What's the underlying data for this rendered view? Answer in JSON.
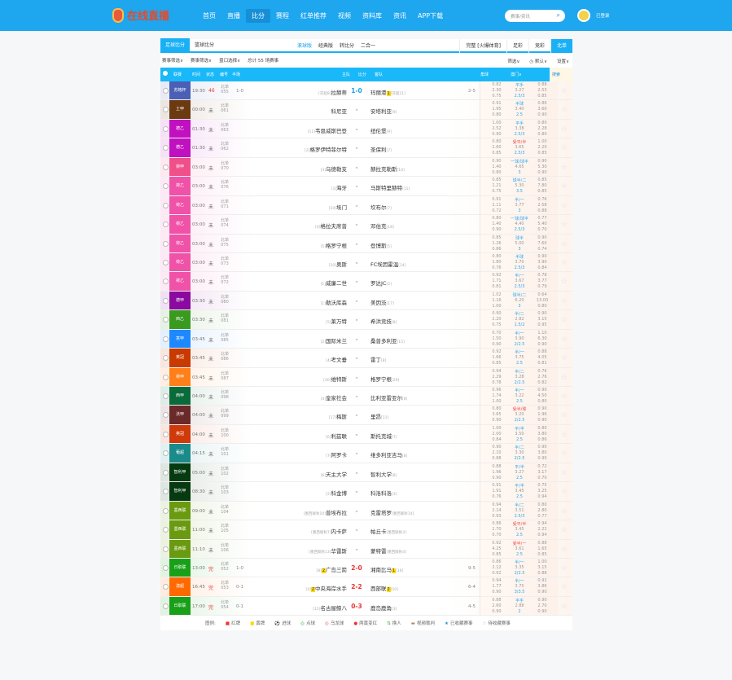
{
  "header": {
    "logo": "在线直播",
    "nav": [
      "首页",
      "直播",
      "比分",
      "赛程",
      "红单推荐",
      "视频",
      "资料库",
      "资讯",
      "APP下载"
    ],
    "active_nav": 2,
    "search_placeholder": "赛事/资讯",
    "user": "已登录"
  },
  "tabs": {
    "sport": [
      "足球比分",
      "篮球比分"
    ],
    "views": [
      "滚球版",
      "经典版",
      "转比分",
      "二合一"
    ],
    "right": [
      "完整 [火爆体育]",
      "足彩",
      "竞彩",
      "北单"
    ]
  },
  "filters": {
    "left": [
      "赛事筛选∨",
      "赛事筛选∨",
      "盘口选择∨",
      "总计 55 场赛事"
    ],
    "right": [
      "筛选∨",
      "◷ 默认∨",
      "设置∨"
    ]
  },
  "columns": {
    "league": "联赛",
    "time": "时间",
    "status": "状态",
    "code": "编号",
    "half": "半场",
    "home": "主队",
    "score": "比分",
    "away": "客队",
    "corner": "角球",
    "odds": "澳门∨",
    "search": "搜索"
  },
  "rows": [
    {
      "league": "苏格杯",
      "color": "#4a5fb5",
      "time": "19:30",
      "status": "46",
      "code": "055",
      "half": "1-0",
      "home": "拉赫蒂",
      "hr": "[芬超8]",
      "score": "1-0",
      "away": "玛丽港",
      "ay": "1",
      "ar": "[芬超11]",
      "corner": "2-5",
      "odds": [
        [
          "0.82",
          "平手",
          "0.88"
        ],
        [
          "2.30",
          "3.27",
          "2.53"
        ],
        [
          "0.75",
          "2.5/3",
          "0.85"
        ]
      ],
      "state": "live"
    },
    {
      "league": "土甲",
      "color": "#6b3a10",
      "time": "00:00",
      "status": "未",
      "code": "061",
      "half": "",
      "home": "科尼亚",
      "hr": "",
      "score": "-",
      "away": "安塔利亚",
      "ar": "[9]",
      "corner": "",
      "odds": [
        [
          "0.91",
          "半球",
          "0.86"
        ],
        [
          "1.95",
          "3.40",
          "3.60"
        ],
        [
          "0.80",
          "2.5",
          "0.90"
        ]
      ]
    },
    {
      "league": "德乙",
      "color": "#c010c0",
      "time": "01:30",
      "status": "未",
      "code": "063",
      "half": "",
      "home": "韦恩威斯巴登",
      "hr": "[11]",
      "score": "-",
      "away": "纽伦堡",
      "ar": "[9]",
      "corner": "",
      "odds": [
        [
          "1.00",
          "平手",
          "0.80"
        ],
        [
          "2.52",
          "3.38",
          "2.28"
        ],
        [
          "0.90",
          "2.5/3",
          "0.80"
        ]
      ]
    },
    {
      "league": "德乙",
      "color": "#c010c0",
      "time": "01:30",
      "status": "未",
      "code": "062",
      "half": "",
      "home": "格罗伊特菲尔特",
      "hr": "[2]",
      "score": "-",
      "away": "圣保利",
      "ar": "[7]",
      "corner": "",
      "odds": [
        [
          "0.80",
          "受平/半",
          "1.00"
        ],
        [
          "2.60",
          "3.65",
          "2.20"
        ],
        [
          "0.85",
          "2.5/3",
          "0.85"
        ]
      ]
    },
    {
      "league": "荷甲",
      "color": "#f0508a",
      "time": "03:00",
      "status": "未",
      "code": "070",
      "half": "",
      "home": "乌德勒支",
      "hr": "[3]",
      "score": "-",
      "away": "赫拉克勒斯",
      "ar": "[14]",
      "corner": "",
      "odds": [
        [
          "0.90",
          "一球/球半",
          "0.90"
        ],
        [
          "1.40",
          "4.65",
          "5.30"
        ],
        [
          "0.80",
          "3",
          "0.90"
        ]
      ]
    },
    {
      "league": "荷乙",
      "color": "#f052a8",
      "time": "03:00",
      "status": "未",
      "code": "076",
      "half": "",
      "home": "海牙",
      "hr": "[3]",
      "score": "-",
      "away": "马斯特里赫特",
      "ar": "[11]",
      "corner": "",
      "odds": [
        [
          "0.85",
          "球半/二",
          "0.85"
        ],
        [
          "1.21",
          "5.30",
          "7.80"
        ],
        [
          "0.75",
          "3.5",
          "0.85"
        ]
      ]
    },
    {
      "league": "荷乙",
      "color": "#f052a8",
      "time": "03:00",
      "status": "未",
      "code": "071",
      "half": "",
      "home": "埃门",
      "hr": "[10]",
      "score": "-",
      "away": "坎布尔",
      "ar": "[7]",
      "corner": "",
      "odds": [
        [
          "0.91",
          "半/一",
          "0.76"
        ],
        [
          "2.11",
          "3.77",
          "2.58"
        ],
        [
          "0.72",
          "3",
          "0.88"
        ]
      ]
    },
    {
      "league": "荷乙",
      "color": "#f052a8",
      "time": "03:00",
      "status": "未",
      "code": "074",
      "half": "",
      "home": "格拉夫席普",
      "hr": "[6]",
      "score": "-",
      "away": "邓伯克",
      "ar": "[18]",
      "corner": "",
      "odds": [
        [
          "0.80",
          "一球/球半",
          "0.77"
        ],
        [
          "1.40",
          "4.40",
          "5.40"
        ],
        [
          "0.90",
          "2.5/3",
          "0.70"
        ]
      ]
    },
    {
      "league": "荷乙",
      "color": "#f052a8",
      "time": "03:00",
      "status": "未",
      "code": "075",
      "half": "",
      "home": "格罗宁根",
      "hr": "[5]",
      "score": "-",
      "away": "登博斯",
      "ar": "[5]",
      "corner": "",
      "odds": [
        [
          "0.85",
          "球半",
          "0.90"
        ],
        [
          "1.26",
          "5.00",
          "7.60"
        ],
        [
          "0.86",
          "3",
          "0.74"
        ]
      ]
    },
    {
      "league": "荷乙",
      "color": "#f052a8",
      "time": "03:00",
      "status": "未",
      "code": "073",
      "half": "",
      "home": "奥斯",
      "hr": "[10]",
      "score": "-",
      "away": "FC埃因霍温",
      "ar": "[14]",
      "corner": "",
      "odds": [
        [
          "0.80",
          "半球",
          "0.90"
        ],
        [
          "1.80",
          "3.70",
          "3.90"
        ],
        [
          "0.76",
          "2.5/3",
          "0.84"
        ]
      ]
    },
    {
      "league": "荷乙",
      "color": "#f052a8",
      "time": "03:00",
      "status": "未",
      "code": "072",
      "half": "",
      "home": "威廉二世",
      "hr": "[1]",
      "score": "-",
      "away": "罗达JC",
      "ar": "[2]",
      "corner": "",
      "odds": [
        [
          "0.92",
          "半/一",
          "0.78"
        ],
        [
          "1.71",
          "3.67",
          "3.77"
        ],
        [
          "0.81",
          "2.5/3",
          "0.79"
        ]
      ]
    },
    {
      "league": "德甲",
      "color": "#8a0aa0",
      "time": "03:30",
      "status": "未",
      "code": "080",
      "half": "",
      "home": "勒沃库森",
      "hr": "[1]",
      "score": "-",
      "away": "美因茨",
      "ar": "[17]",
      "corner": "",
      "odds": [
        [
          "1.02",
          "球半/二",
          "0.64"
        ],
        [
          "1.16",
          "6.20",
          "13.00"
        ],
        [
          "1.00",
          "3",
          "0.80"
        ]
      ]
    },
    {
      "league": "西乙",
      "color": "#3a9a20",
      "time": "03:30",
      "status": "未",
      "code": "081",
      "half": "",
      "home": "莱万特",
      "hr": "[5]",
      "score": "-",
      "away": "希洪竞技",
      "ar": "[8]",
      "corner": "",
      "odds": [
        [
          "0.90",
          "半/二",
          "0.90"
        ],
        [
          "2.20",
          "2.82",
          "3.15"
        ],
        [
          "0.75",
          "1.5/2",
          "0.95"
        ]
      ]
    },
    {
      "league": "意甲",
      "color": "#1e88ff",
      "time": "03:45",
      "status": "未",
      "code": "085",
      "half": "",
      "home": "国际米兰",
      "hr": "[2]",
      "score": "-",
      "away": "桑普多利亚",
      "ar": "[15]",
      "corner": "",
      "odds": [
        [
          "0.70",
          "半/一",
          "1.10"
        ],
        [
          "1.50",
          "3.90",
          "6.30"
        ],
        [
          "0.90",
          "2/2.5",
          "0.90"
        ]
      ]
    },
    {
      "league": "英冠",
      "color": "#c83a00",
      "time": "03:45",
      "status": "未",
      "code": "086",
      "half": "",
      "home": "考文垂",
      "hr": "[4]",
      "score": "-",
      "away": "雷丁",
      "ar": "[8]",
      "corner": "",
      "odds": [
        [
          "0.92",
          "半/一",
          "0.88"
        ],
        [
          "1.66",
          "3.75",
          "4.05"
        ],
        [
          "0.85",
          "2.5",
          "0.81"
        ]
      ]
    },
    {
      "league": "荷甲",
      "color": "#ff7f1a",
      "time": "03:45",
      "status": "未",
      "code": "087",
      "half": "",
      "home": "维特斯",
      "hr": "[20]",
      "score": "-",
      "away": "格罗宁根",
      "ar": "[29]",
      "corner": "",
      "odds": [
        [
          "0.94",
          "半/二",
          "0.76"
        ],
        [
          "2.29",
          "3.28",
          "2.76"
        ],
        [
          "0.78",
          "2/2.5",
          "0.82"
        ]
      ]
    },
    {
      "league": "西甲",
      "color": "#0a6b3a",
      "time": "04:00",
      "status": "未",
      "code": "098",
      "half": "",
      "home": "皇家社会",
      "hr": "[4]",
      "score": "-",
      "away": "比利亚雷亚尔",
      "ar": "[8]",
      "corner": "",
      "odds": [
        [
          "0.96",
          "半/一",
          "0.90"
        ],
        [
          "1.74",
          "3.22",
          "4.50"
        ],
        [
          "1.00",
          "2.5",
          "0.80"
        ]
      ]
    },
    {
      "league": "法甲",
      "color": "#6a2a2a",
      "time": "04:00",
      "status": "未",
      "code": "099",
      "half": "",
      "home": "梅斯",
      "hr": "[17]",
      "score": "-",
      "away": "里昂",
      "ar": "[11]",
      "corner": "",
      "odds": [
        [
          "0.80",
          "受半/球",
          "0.90"
        ],
        [
          "3.65",
          "3.20",
          "1.96"
        ],
        [
          "0.90",
          "2/2.5",
          "0.90"
        ]
      ]
    },
    {
      "league": "英冠",
      "color": "#d03a0a",
      "time": "04:00",
      "status": "未",
      "code": "100",
      "half": "",
      "home": "利兹联",
      "hr": "[6]",
      "score": "-",
      "away": "斯托克城",
      "ar": "[7]",
      "corner": "",
      "odds": [
        [
          "1.00",
          "平/半",
          "0.80"
        ],
        [
          "2.00",
          "3.50",
          "3.80"
        ],
        [
          "0.84",
          "2.5",
          "0.86"
        ]
      ]
    },
    {
      "league": "葡超",
      "color": "#1a8a8a",
      "time": "04:15",
      "status": "未",
      "code": "101",
      "half": "",
      "home": "阿罗卡",
      "hr": "[7]",
      "score": "-",
      "away": "维多利亚吉马",
      "ar": "[8]",
      "corner": "",
      "odds": [
        [
          "0.90",
          "半/二",
          "0.90"
        ],
        [
          "2.10",
          "3.30",
          "3.80"
        ],
        [
          "0.88",
          "2/2.5",
          "0.90"
        ]
      ]
    },
    {
      "league": "智利甲",
      "color": "#063a10",
      "time": "05:00",
      "status": "未",
      "code": "102",
      "half": "",
      "home": "天主大学",
      "hr": "[6]",
      "score": "-",
      "away": "智利大学",
      "ar": "[8]",
      "corner": "",
      "odds": [
        [
          "0.88",
          "平/半",
          "0.72"
        ],
        [
          "1.96",
          "3.27",
          "3.17"
        ],
        [
          "0.90",
          "2.5",
          "0.70"
        ]
      ]
    },
    {
      "league": "智利甲",
      "color": "#063a10",
      "time": "08:30",
      "status": "未",
      "code": "103",
      "half": "",
      "home": "科金博",
      "hr": "[2]",
      "score": "-",
      "away": "科洛科洛",
      "ar": "[3]",
      "corner": "",
      "odds": [
        [
          "0.91",
          "平/半",
          "0.75"
        ],
        [
          "1.91",
          "3.45",
          "3.25"
        ],
        [
          "0.76",
          "2.5",
          "0.94"
        ]
      ]
    },
    {
      "league": "墨西联",
      "color": "#6a9a10",
      "time": "09:00",
      "status": "未",
      "code": "104",
      "half": "",
      "home": "普埃布拉",
      "hr": "[墨西联秋10]",
      "score": "-",
      "away": "克雷塔罗",
      "ar": "[墨西联秋14]",
      "corner": "",
      "odds": [
        [
          "0.94",
          "半/二",
          "0.80"
        ],
        [
          "2.14",
          "3.51",
          "2.80"
        ],
        [
          "0.93",
          "2.5/3",
          "0.77"
        ]
      ]
    },
    {
      "league": "墨西联",
      "color": "#6a9a10",
      "time": "11:00",
      "status": "未",
      "code": "105",
      "half": "",
      "home": "内卡萨",
      "hr": "[墨西联秋7]",
      "score": "-",
      "away": "帕丘卡",
      "ar": "[墨西联秋3]",
      "corner": "",
      "odds": [
        [
          "0.86",
          "受平/半",
          "0.94"
        ],
        [
          "2.70",
          "3.45",
          "2.22"
        ],
        [
          "0.70",
          "2.5",
          "0.94"
        ]
      ]
    },
    {
      "league": "墨西联",
      "color": "#6a9a10",
      "time": "11:10",
      "status": "未",
      "code": "106",
      "half": "",
      "home": "华雷斯",
      "hr": "[墨西联秋13]",
      "score": "-",
      "away": "蒙特雷",
      "ar": "[墨西联秋4]",
      "corner": "",
      "odds": [
        [
          "0.92",
          "受半/一",
          "0.88"
        ],
        [
          "4.25",
          "3.61",
          "1.65"
        ],
        [
          "0.85",
          "2.5",
          "0.85"
        ]
      ]
    },
    {
      "league": "日职联",
      "color": "#18a018",
      "time": "13:00",
      "status": "完",
      "code": "052",
      "half": "1-0",
      "home": "广岛三箭",
      "hy": "2",
      "hr": "[8]",
      "score": "2-0",
      "away": "湘南比马",
      "ay": "1",
      "ar": "[16]",
      "corner": "9-5",
      "odds": [
        [
          "0.86",
          "半/一",
          "1.00"
        ],
        [
          "2.12",
          "3.35",
          "3.15"
        ],
        [
          "0.92",
          "2/2.5",
          "0.88"
        ]
      ],
      "state": "done"
    },
    {
      "league": "澳超",
      "color": "#ff6a00",
      "time": "16:45",
      "status": "完",
      "code": "053",
      "half": "0-1",
      "home": "中央海岸水手",
      "hy": "2",
      "hr": "[4]",
      "score": "2-2",
      "away": "西部联",
      "ay": "2",
      "ar": "[10]",
      "corner": "6-4",
      "odds": [
        [
          "0.94",
          "半/一",
          "0.92"
        ],
        [
          "1.77",
          "3.75",
          "3.86"
        ],
        [
          "0.90",
          "3/3.5",
          "0.90"
        ]
      ],
      "state": "done"
    },
    {
      "league": "日职联",
      "color": "#18a018",
      "time": "17:00",
      "status": "完",
      "code": "054",
      "half": "0-1",
      "home": "名古屋鲸八",
      "hr": "[15]",
      "score": "0-3",
      "away": "鹿岛鹿角",
      "ar": "[3]",
      "corner": "4-5",
      "odds": [
        [
          "0.88",
          "平手",
          "0.90"
        ],
        [
          "2.60",
          "2.88",
          "2.70"
        ],
        [
          "0.90",
          "2",
          "0.90"
        ]
      ],
      "state": "done"
    }
  ],
  "code_prefix": "北单",
  "legend": {
    "title": "图例:",
    "items": [
      "红牌",
      "黄牌",
      "进球",
      "点球",
      "乌龙球",
      "两黄变红",
      "换人",
      "视频裁判",
      "已收藏赛事",
      "待收藏赛事"
    ]
  }
}
